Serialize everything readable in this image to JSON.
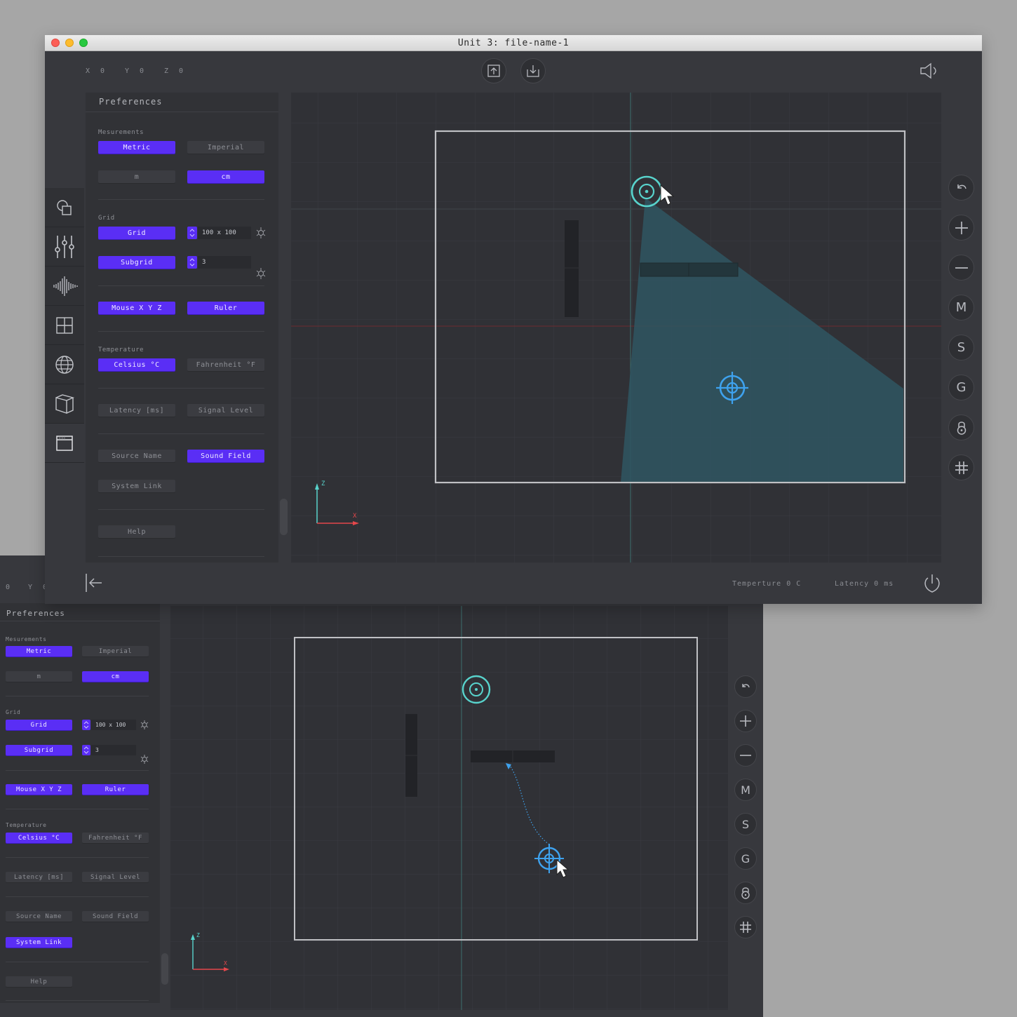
{
  "window_a": {
    "title": "Unit 3: file-name-1",
    "coords": {
      "x": "X  0",
      "y": "Y  0",
      "z": "Z  0"
    },
    "status": {
      "temperature": "Temperture 0 C",
      "latency": "Latency 0 ms"
    }
  },
  "window_b": {
    "coords": {
      "x": "0",
      "y": "Y  0"
    }
  },
  "prefs": {
    "title": "Preferences",
    "measurements_label": "Mesurements",
    "metric": "Metric",
    "imperial": "Imperial",
    "m": "m",
    "cm": "cm",
    "grid_label": "Grid",
    "grid_btn": "Grid",
    "grid_size": "100 x 100",
    "subgrid_btn": "Subgrid",
    "subgrid_value": "3",
    "mouse_xyz": "Mouse X Y Z",
    "ruler": "Ruler",
    "temperature_label": "Temperature",
    "celsius": "Celsius °C",
    "fahrenheit": "Fahrenheit °F",
    "latency": "Latency [ms]",
    "signal_level": "Signal Level",
    "source_name": "Source Name",
    "sound_field": "Sound Field",
    "system_link": "System Link",
    "help": "Help"
  },
  "right_toolbar": {
    "m": "M",
    "s": "S",
    "g": "G"
  },
  "axis": {
    "z": "Z",
    "x": "X"
  },
  "colors": {
    "accent": "#5a2ef5",
    "cyan": "#58d3cc",
    "blue": "#3ea2ee",
    "field": "#2f5661"
  }
}
